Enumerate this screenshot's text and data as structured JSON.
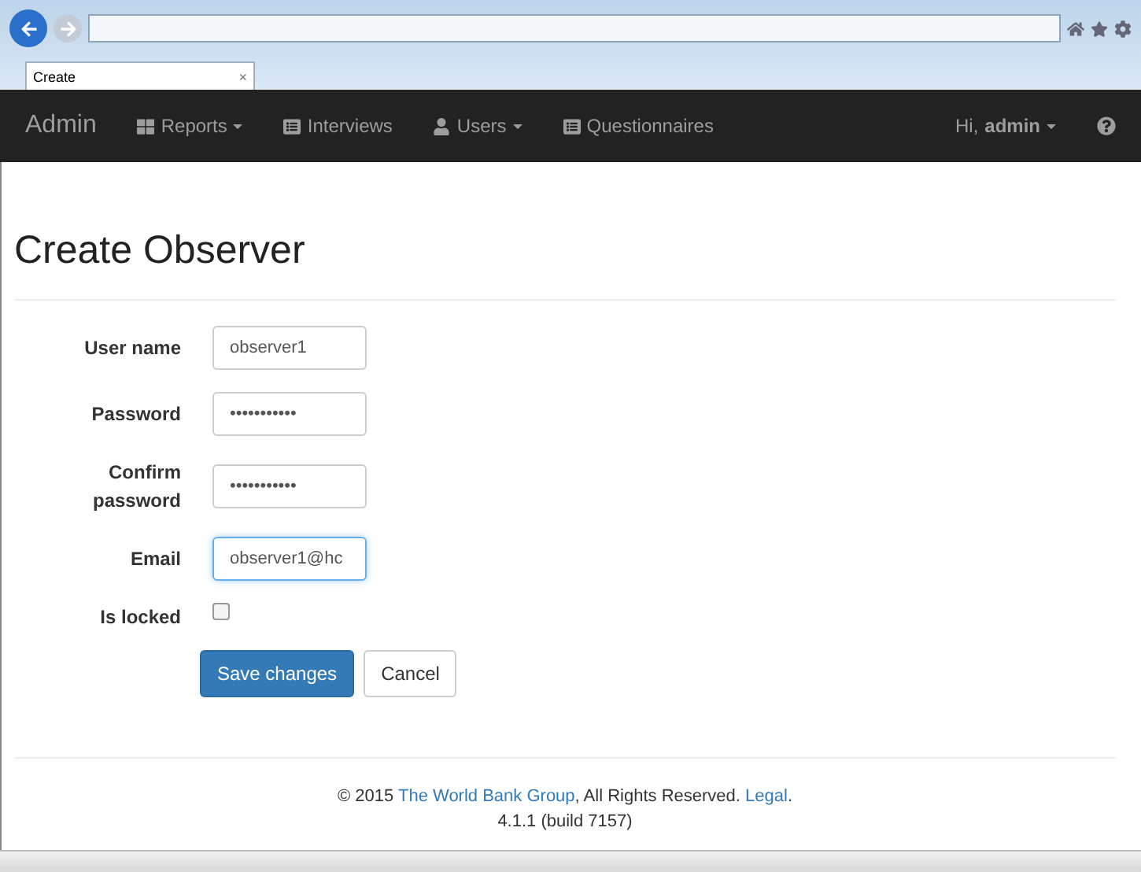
{
  "browser": {
    "tab": {
      "title": "Create",
      "close": "×"
    }
  },
  "navbar": {
    "brand": "Admin",
    "items": [
      {
        "label": "Reports",
        "kind": "grid",
        "dropdown": true
      },
      {
        "label": "Interviews",
        "kind": "list",
        "dropdown": false
      },
      {
        "label": "Users",
        "kind": "user",
        "dropdown": true
      },
      {
        "label": "Questionnaires",
        "kind": "list",
        "dropdown": false
      }
    ],
    "user": {
      "greeting": "Hi,",
      "name": "admin",
      "dropdown": true
    }
  },
  "page": {
    "title": "Create Observer"
  },
  "form": {
    "fields": [
      {
        "kind": "text",
        "label": "User name",
        "value": "observer1",
        "focused": false
      },
      {
        "kind": "password",
        "label": "Password",
        "value": "•••••••••••",
        "focused": false
      },
      {
        "kind": "password",
        "label": "Confirm password",
        "value": "•••••••••••",
        "focused": false
      },
      {
        "kind": "text",
        "label": "Email",
        "value": "observer1@hc",
        "focused": true
      },
      {
        "kind": "checkbox",
        "label": "Is locked",
        "checked": false
      }
    ],
    "buttons": [
      {
        "label": "Save changes",
        "primary": true
      },
      {
        "label": "Cancel",
        "primary": false
      }
    ]
  },
  "footer": {
    "copyright": "© 2015",
    "org": "The World Bank Group",
    "rights": ", All Rights Reserved.",
    "legal": "Legal",
    "end": ".",
    "version": "4.1.1 (build 7157)"
  }
}
